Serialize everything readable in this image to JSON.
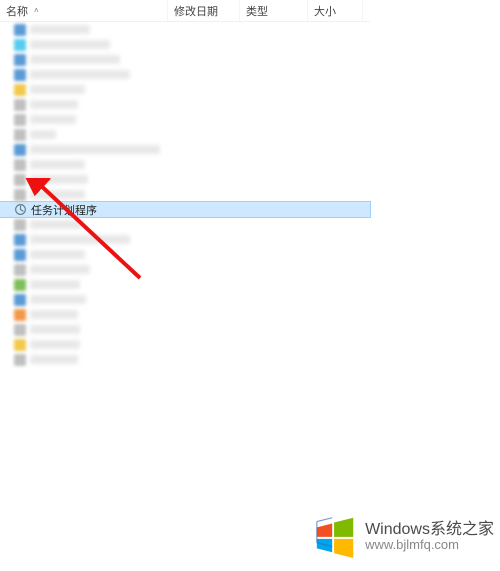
{
  "columns": {
    "name": "名称",
    "date": "修改日期",
    "type": "类型",
    "size": "大小"
  },
  "selected_item": {
    "label": "任务计划程序"
  },
  "icon_palette": [
    "blue",
    "teal",
    "blue",
    "blue",
    "yellow",
    "grey",
    "grey",
    "grey",
    "blue",
    "grey",
    "grey",
    "grey",
    "task",
    "grey",
    "blue",
    "blue",
    "grey",
    "green",
    "blue",
    "orange",
    "grey",
    "yellow",
    "grey"
  ],
  "name_widths": [
    60,
    80,
    90,
    100,
    55,
    48,
    46,
    26,
    130,
    55,
    58,
    55,
    0,
    52,
    100,
    55,
    60,
    50,
    56,
    48,
    50,
    50,
    48
  ],
  "watermark": {
    "main_left": "Windows",
    "main_right": "系统之家",
    "url": "www.bjlmfq.com"
  }
}
